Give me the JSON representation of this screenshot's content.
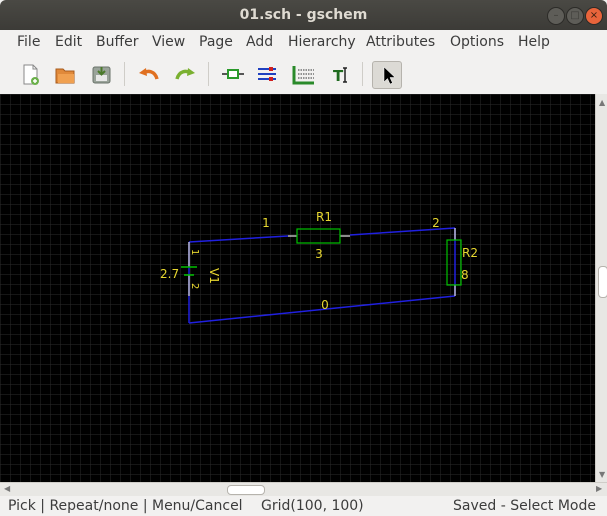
{
  "window": {
    "title": "01.sch - gschem"
  },
  "menu": [
    "File",
    "Edit",
    "Buffer",
    "View",
    "Page",
    "Add",
    "Hierarchy",
    "Attributes",
    "Options",
    "Help"
  ],
  "toolbar": [
    "new-file-icon",
    "open-file-icon",
    "save-file-icon",
    "undo-icon",
    "redo-icon",
    "add-component-icon",
    "add-net-icon",
    "add-bus-icon",
    "add-text-icon",
    "select-pointer-icon"
  ],
  "schematic": {
    "components": {
      "r1": {
        "refdes": "R1",
        "pin_left": "1",
        "pin_right": "2"
      },
      "r2": {
        "refdes": "R2"
      },
      "v1": {
        "refdes": "V1",
        "value": "2.7",
        "pin_top": "1",
        "pin_bottom": "2"
      }
    },
    "nets": {
      "n1": "1",
      "n2": "2",
      "n3": "3",
      "n8": "8",
      "n0": "0"
    },
    "colors": {
      "background": "#000000",
      "grid": "#303030",
      "net": "#2020e0",
      "component": "#00c000",
      "text": "#e8d830",
      "pin": "#e0e0e0"
    }
  },
  "status": {
    "left": "Pick | Repeat/none | Menu/Cancel",
    "grid": "Grid(100, 100)",
    "right": "Saved - Select Mode"
  }
}
